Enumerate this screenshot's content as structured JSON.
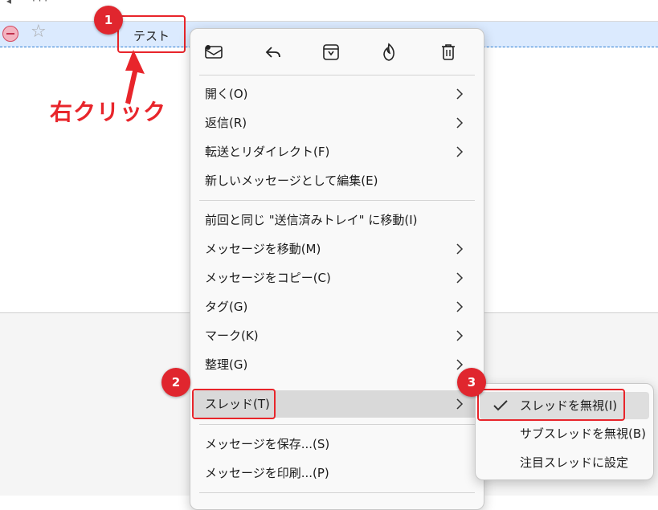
{
  "topbar": {
    "frag1": "◂",
    "frag2": "· · ·"
  },
  "message": {
    "subject": "テスト"
  },
  "annotation": {
    "text": "右クリック",
    "badge1": "1",
    "badge2": "2",
    "badge3": "3",
    "color": "#e8252b"
  },
  "menu": {
    "icons": [
      "mark-read-icon",
      "reply-icon",
      "archive-icon",
      "junk-icon",
      "delete-icon"
    ],
    "group1": [
      {
        "label": "開く(O)",
        "submenu": true
      },
      {
        "label": "返信(R)",
        "submenu": true
      },
      {
        "label": "転送とリダイレクト(F)",
        "submenu": true
      },
      {
        "label": "新しいメッセージとして編集(E)",
        "submenu": false
      }
    ],
    "group2": [
      {
        "label": "前回と同じ \"送信済みトレイ\" に移動(I)",
        "submenu": false
      },
      {
        "label": "メッセージを移動(M)",
        "submenu": true
      },
      {
        "label": "メッセージをコピー(C)",
        "submenu": true
      },
      {
        "label": "タグ(G)",
        "submenu": true
      },
      {
        "label": "マーク(K)",
        "submenu": true
      },
      {
        "label": "整理(G)",
        "submenu": true
      },
      {
        "label": "スレッド(T)",
        "submenu": true
      }
    ],
    "group3": [
      {
        "label": "メッセージを保存...(S)",
        "submenu": false
      },
      {
        "label": "メッセージを印刷...(P)",
        "submenu": false
      }
    ]
  },
  "submenu": {
    "items": [
      {
        "label": "スレッドを無視(I)",
        "checked": true
      },
      {
        "label": "サブスレッドを無視(B)",
        "checked": false
      },
      {
        "label": "注目スレッドに設定",
        "checked": false
      }
    ]
  }
}
